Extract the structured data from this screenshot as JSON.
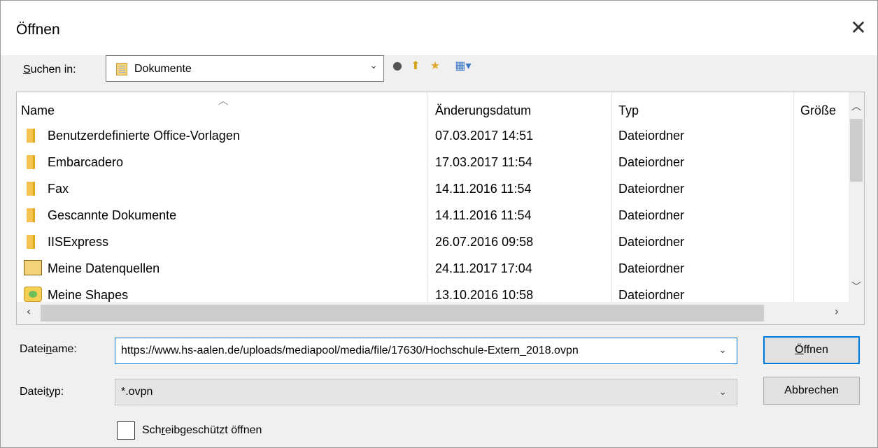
{
  "dialog": {
    "title": "Öffnen",
    "close_glyph": "✕"
  },
  "lookin": {
    "label_pre": "",
    "label_u": "S",
    "label_post": "uchen in:",
    "value": "Dokumente",
    "icon": "documents-folder-icon"
  },
  "toolbar": {
    "back_glyph": "●",
    "up_glyph": "⬆",
    "new_folder_glyph": "★",
    "view_glyph": "▦▾"
  },
  "columns": [
    "Name",
    "Änderungsdatum",
    "Typ",
    "Größe"
  ],
  "files": [
    {
      "name": "Benutzerdefinierte Office-Vorlagen",
      "date": "07.03.2017 14:51",
      "type": "Dateiordner",
      "icon": "folder-icon"
    },
    {
      "name": "Embarcadero",
      "date": "17.03.2017 11:54",
      "type": "Dateiordner",
      "icon": "folder-icon"
    },
    {
      "name": "Fax",
      "date": "14.11.2016 11:54",
      "type": "Dateiordner",
      "icon": "folder-icon"
    },
    {
      "name": "Gescannte Dokumente",
      "date": "14.11.2016 11:54",
      "type": "Dateiordner",
      "icon": "folder-icon"
    },
    {
      "name": "IISExpress",
      "date": "26.07.2016 09:58",
      "type": "Dateiordner",
      "icon": "folder-icon"
    },
    {
      "name": "Meine Datenquellen",
      "date": "24.11.2017 17:04",
      "type": "Dateiordner",
      "icon": "data-sources-folder-icon"
    },
    {
      "name": "Meine Shapes",
      "date": "13.10.2016 10:58",
      "type": "Dateiordner",
      "icon": "shapes-folder-icon"
    }
  ],
  "filename": {
    "label_pre": "Datei",
    "label_u": "n",
    "label_post": "ame:",
    "value": "https://www.hs-aalen.de/uploads/mediapool/media/file/17630/Hochschule-Extern_2018.ovpn"
  },
  "filetype": {
    "label_pre": "Datei",
    "label_u": "t",
    "label_post": "yp:",
    "value": "*.ovpn"
  },
  "buttons": {
    "open_pre": "",
    "open_u": "Ö",
    "open_post": "ffnen",
    "cancel": "Abbrechen"
  },
  "readonly": {
    "label_pre": "Sch",
    "label_u": "r",
    "label_post": "eibgeschützt öffnen",
    "checked": false
  }
}
